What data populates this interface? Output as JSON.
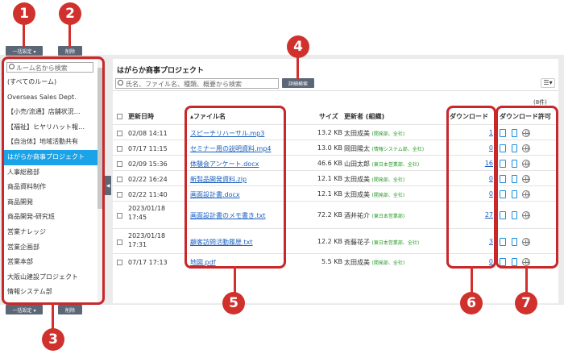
{
  "toolbar": {
    "bulk_label": "一括設定 ▾",
    "delete_label": "削除"
  },
  "sidebar": {
    "search_placeholder": "ルーム名から検索",
    "items": [
      {
        "label": "(すべてのルーム)"
      },
      {
        "label": "Overseas Sales Dept."
      },
      {
        "label": "【小売/流通】店舗状況…"
      },
      {
        "label": "【福祉】ヒヤリハット報…"
      },
      {
        "label": "【自治体】地域活動共有"
      },
      {
        "label": "はがらか商事プロジェクト"
      },
      {
        "label": "人事総務部"
      },
      {
        "label": "商品資料制作"
      },
      {
        "label": "商品開発"
      },
      {
        "label": "商品開発-研究班"
      },
      {
        "label": "営業ナレッジ"
      },
      {
        "label": "営業企画部"
      },
      {
        "label": "営業本部"
      },
      {
        "label": "大阪山建設プロジェクト"
      },
      {
        "label": "情報システム部"
      }
    ],
    "selected_index": 5
  },
  "main": {
    "title": "はがらか商事プロジェクト",
    "search_placeholder": "氏名、ファイル名、種類、概要から検索",
    "detail_search_label": "詳細検索",
    "count_label": "(8件)",
    "headers": {
      "date": "更新日時",
      "file": "▴ファイル名",
      "size": "サイズ",
      "updater": "更新者 (組織)",
      "downloads": "ダウンロード",
      "perm": "ダウンロード許可"
    },
    "rows": [
      {
        "date": "02/08 14:11",
        "file": "スピーチリハーサル.mp3",
        "size": "13.2 KB",
        "name": "太田成美",
        "org": "(開発部、全社)",
        "dl": "1"
      },
      {
        "date": "07/17 11:15",
        "file": "セミナー用の説明資料.mp4",
        "size": "13.0 KB",
        "name": "岡田陽太",
        "org": "(情報システム部、全社)",
        "dl": "0"
      },
      {
        "date": "02/09 15:36",
        "file": "体験会アンケート.docx",
        "size": "46.6 KB",
        "name": "山田太郎",
        "org": "(東日本営業部、全社)",
        "dl": "16"
      },
      {
        "date": "02/22 16:24",
        "file": "新製品開発資料.zip",
        "size": "12.1 KB",
        "name": "太田成美",
        "org": "(開発部、全社)",
        "dl": "0"
      },
      {
        "date": "02/22 11:40",
        "file": "画面設計書.docx",
        "size": "12.1 KB",
        "name": "太田成美",
        "org": "(開発部、全社)",
        "dl": "0"
      },
      {
        "date": "2023/01/18 17:45",
        "file": "画面設計書のメモ書き.txt",
        "size": "72.2 KB",
        "name": "酒井祐介",
        "org": "(東日本営業部)",
        "dl": "27"
      },
      {
        "date": "2023/01/18 17:31",
        "file": "顧客訪問活動履歴.txt",
        "size": "12.2 KB",
        "name": "斉藤花子",
        "org": "(東日本営業部、全社)",
        "dl": "3"
      },
      {
        "date": "07/17 17:13",
        "file": "地図.pdf",
        "size": "5.5 KB",
        "name": "太田成美",
        "org": "(開発部、全社)",
        "dl": "0"
      }
    ]
  },
  "callouts": [
    "1",
    "2",
    "3",
    "4",
    "5",
    "6",
    "7"
  ],
  "colors": {
    "callout": "#d0312d",
    "selected": "#1aa3e8",
    "button": "#5b6677",
    "link": "#1a5fbf",
    "org": "#2a9b2a"
  }
}
